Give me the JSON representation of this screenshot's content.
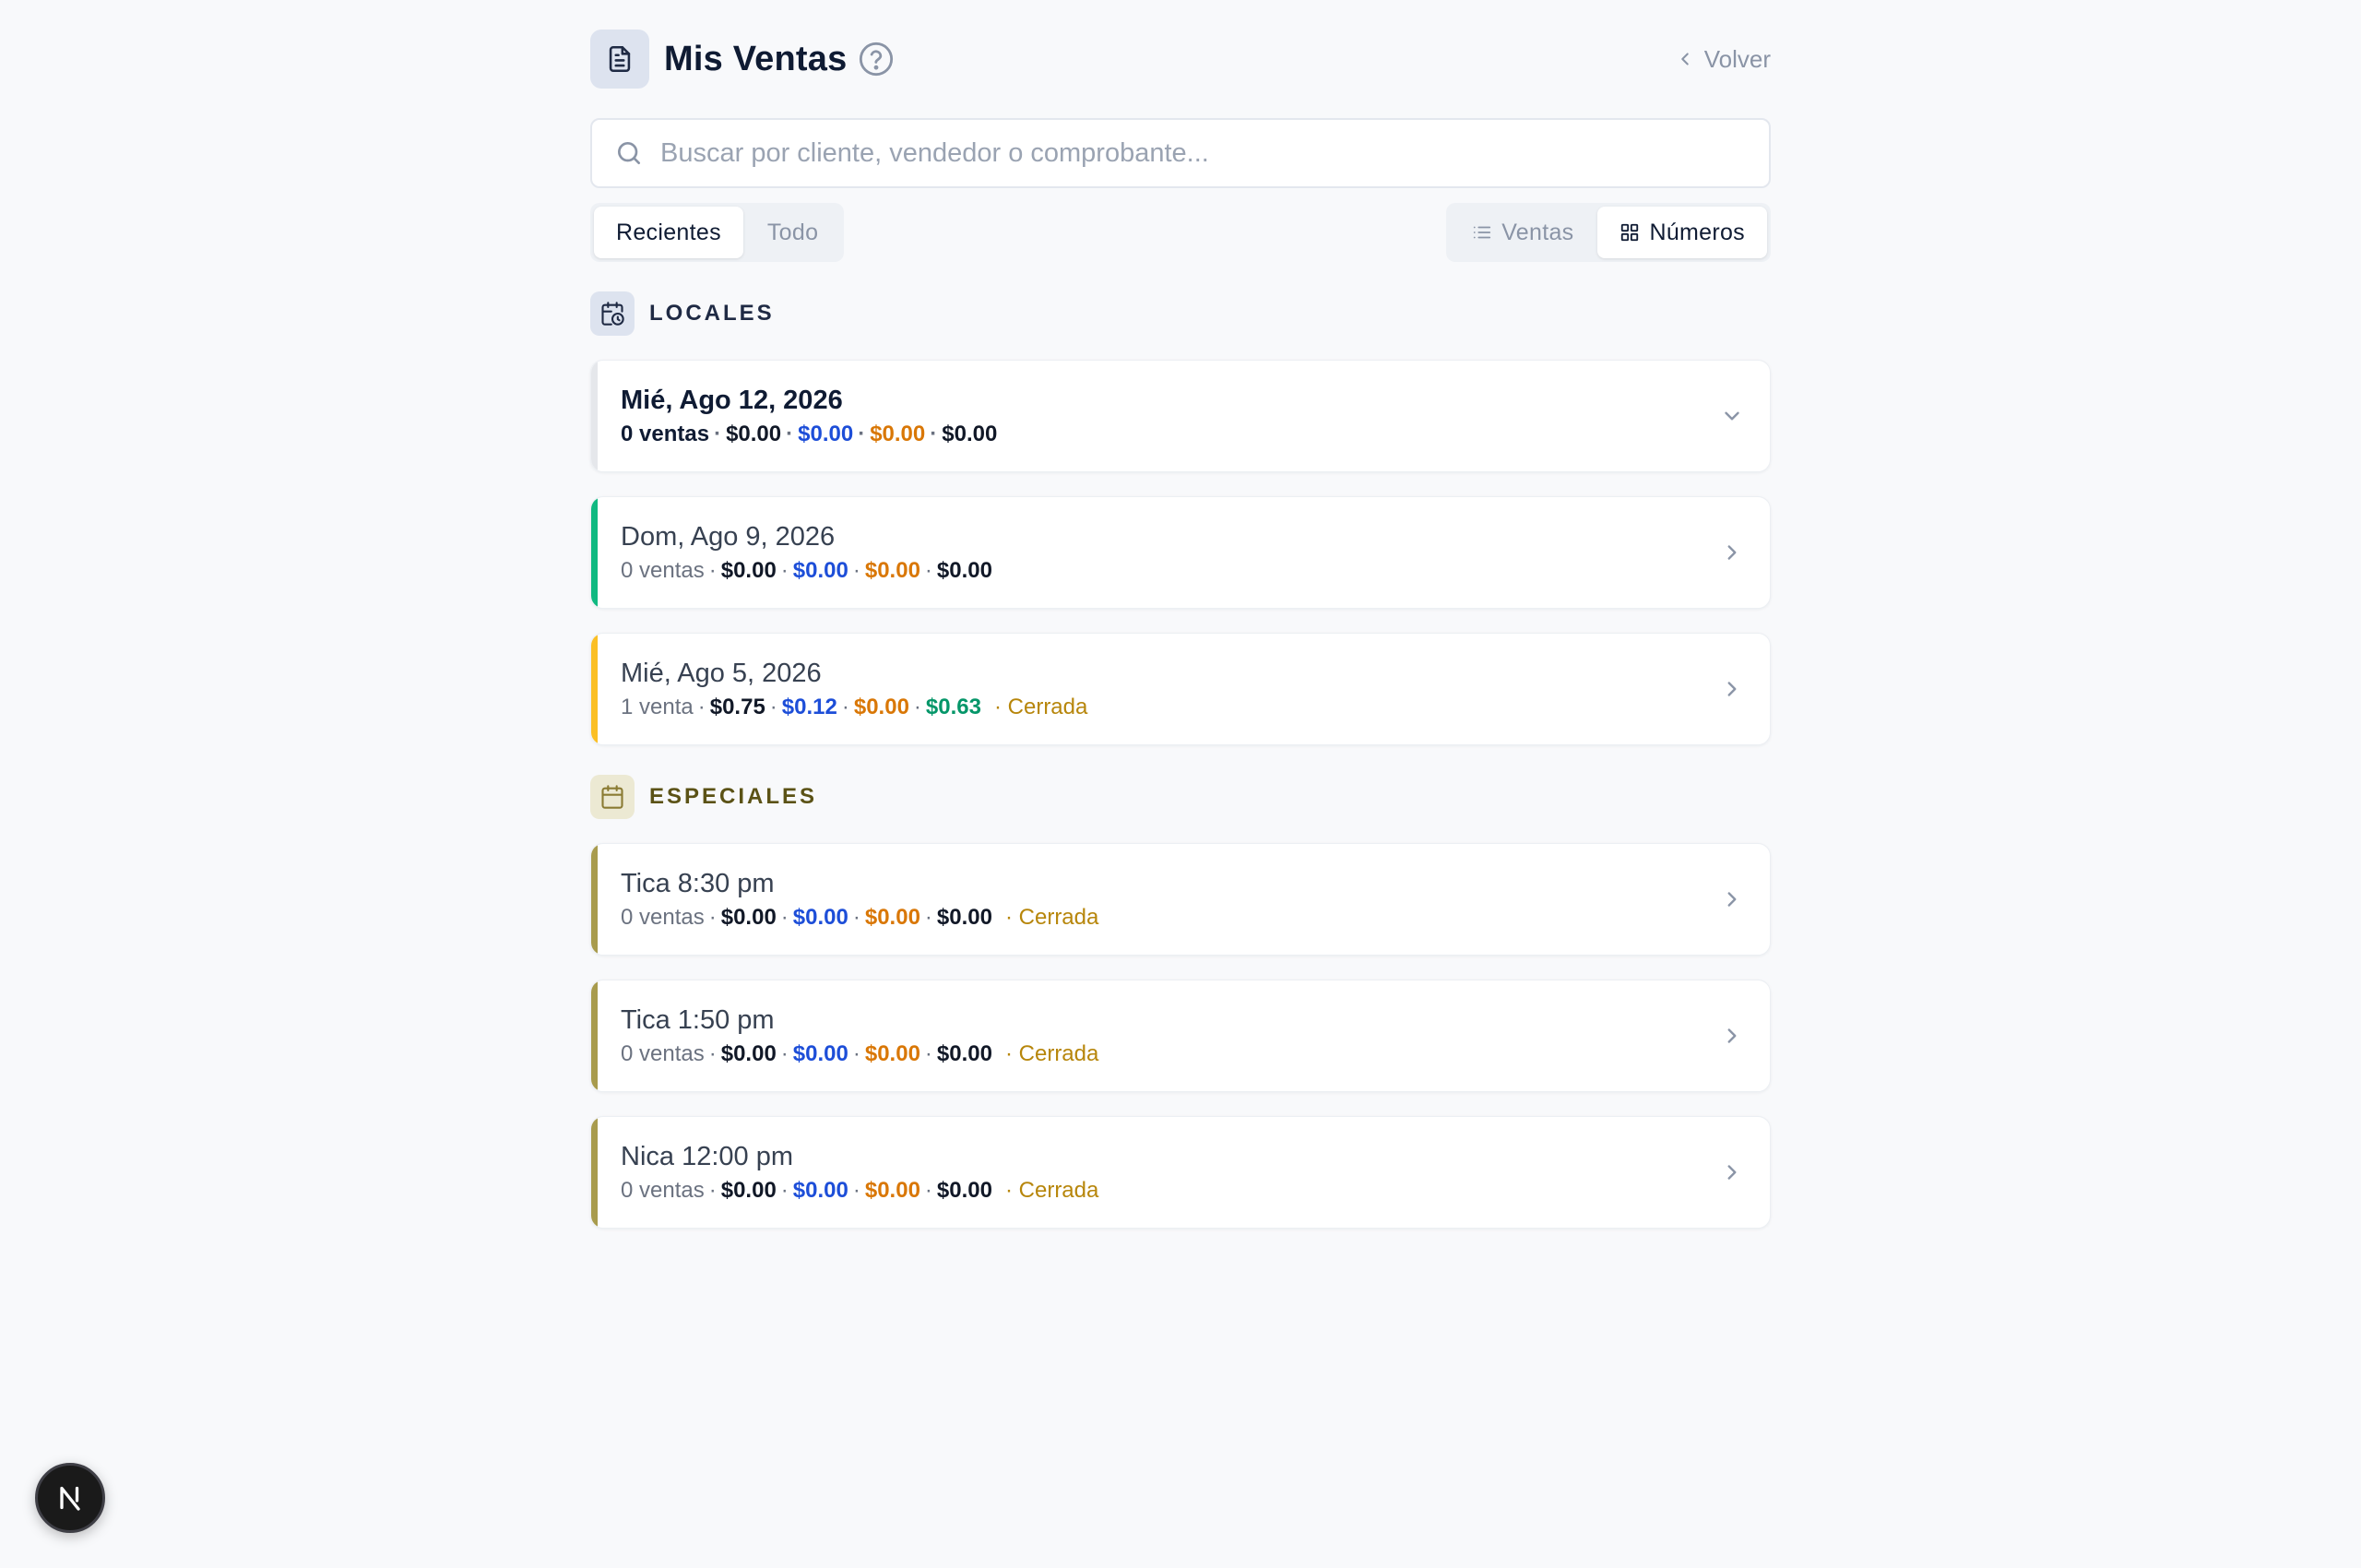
{
  "header": {
    "title": "Mis Ventas",
    "back_label": "Volver"
  },
  "search": {
    "placeholder": "Buscar por cliente, vendedor o comprobante..."
  },
  "range_tabs": [
    {
      "label": "Recientes",
      "active": true
    },
    {
      "label": "Todo",
      "active": false
    }
  ],
  "view_tabs": [
    {
      "label": "Ventas",
      "icon": "list-icon",
      "active": false
    },
    {
      "label": "Números",
      "icon": "grid-icon",
      "active": true
    }
  ],
  "sections": {
    "locales": {
      "label": "LOCALES",
      "icon": "calendar-clock-icon"
    },
    "especiales": {
      "label": "ESPECIALES",
      "icon": "calendar-icon"
    }
  },
  "colors": {
    "accent_green": "#10b981",
    "accent_yellow": "#fbbf24",
    "accent_olive": "#a89b4d",
    "accent_neutral": "#e5e7eb",
    "blue": "#1d4ed8",
    "orange": "#d97706",
    "green": "#059669"
  },
  "locales": [
    {
      "title": "Mié, Ago 12, 2026",
      "count": "0 ventas",
      "v1": "$0.00",
      "v2": "$0.00",
      "v3": "$0.00",
      "v4": "$0.00",
      "status": "",
      "expanded": true
    },
    {
      "title": "Dom, Ago 9, 2026",
      "count": "0 ventas",
      "v1": "$0.00",
      "v2": "$0.00",
      "v3": "$0.00",
      "v4": "$0.00",
      "status": ""
    },
    {
      "title": "Mié, Ago 5, 2026",
      "count": "1 venta",
      "v1": "$0.75",
      "v2": "$0.12",
      "v3": "$0.00",
      "v4": "$0.63",
      "status": "· Cerrada"
    }
  ],
  "especiales": [
    {
      "title": "Tica 8:30 pm",
      "count": "0 ventas",
      "v1": "$0.00",
      "v2": "$0.00",
      "v3": "$0.00",
      "v4": "$0.00",
      "status": "· Cerrada"
    },
    {
      "title": "Tica 1:50 pm",
      "count": "0 ventas",
      "v1": "$0.00",
      "v2": "$0.00",
      "v3": "$0.00",
      "v4": "$0.00",
      "status": "· Cerrada"
    },
    {
      "title": "Nica 12:00 pm",
      "count": "0 ventas",
      "v1": "$0.00",
      "v2": "$0.00",
      "v3": "$0.00",
      "v4": "$0.00",
      "status": "· Cerrada"
    }
  ],
  "dev_badge": {
    "letter": "N"
  }
}
